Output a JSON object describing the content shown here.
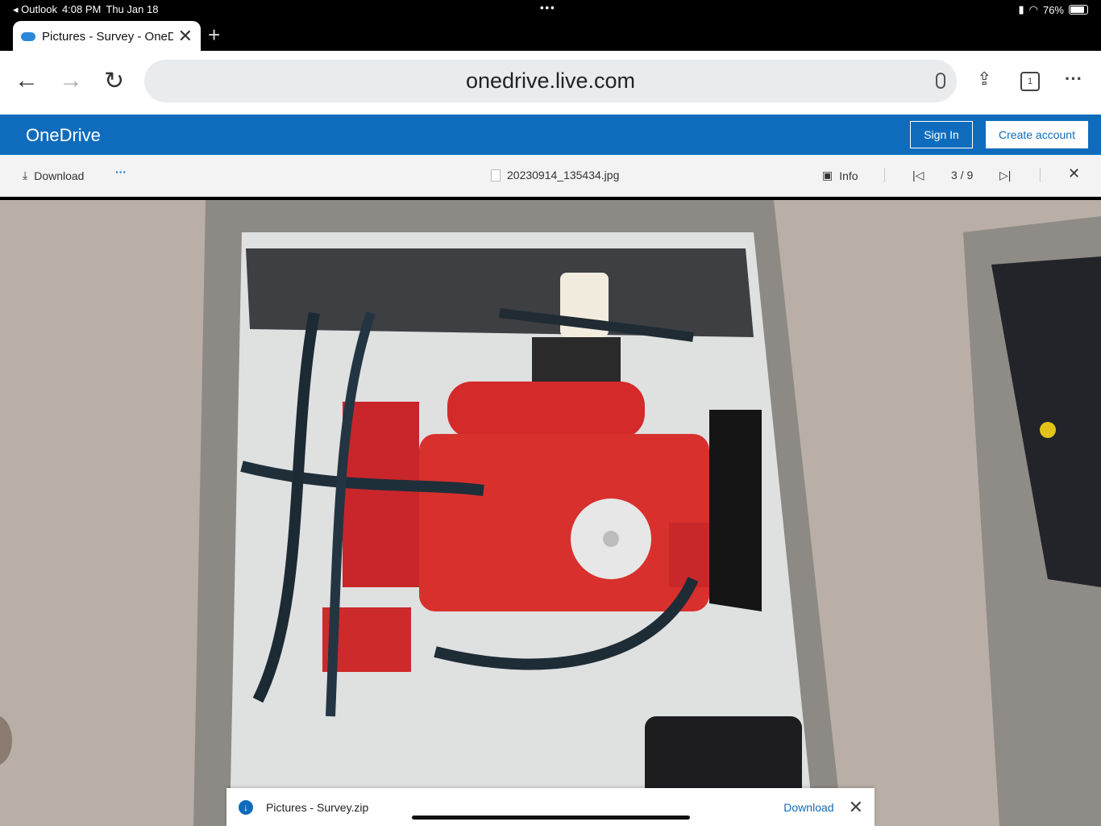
{
  "status": {
    "back_app": "◂ Outlook",
    "time": "4:08 PM",
    "date": "Thu Jan 18",
    "dots": "•••",
    "battery": "76%",
    "battery_level": 0.76
  },
  "browser": {
    "tab_title": "Pictures - Survey - OneDrive",
    "url": "onedrive.live.com",
    "tab_count": "1"
  },
  "onedrive": {
    "brand": "OneDrive",
    "sign_in": "Sign In",
    "create_account": "Create account"
  },
  "viewer": {
    "download_label": "Download",
    "more": "···",
    "filename": "20230914_135434.jpg",
    "info_label": "Info",
    "position": "3 / 9"
  },
  "download_bar": {
    "file": "Pictures - Survey.zip",
    "action": "Download"
  },
  "icons": {
    "back": "back-arrow-icon",
    "forward": "forward-arrow-icon",
    "reload": "reload-icon",
    "mic": "microphone-icon",
    "share": "share-icon",
    "tabs": "tabs-icon",
    "menu": "ellipsis-icon",
    "download": "download-icon",
    "info": "info-panel-icon",
    "first": "first-page-icon",
    "last": "last-page-icon",
    "close": "close-icon"
  },
  "colors": {
    "brand_blue": "#0f6cbd",
    "engine_red": "#d42a2a"
  }
}
